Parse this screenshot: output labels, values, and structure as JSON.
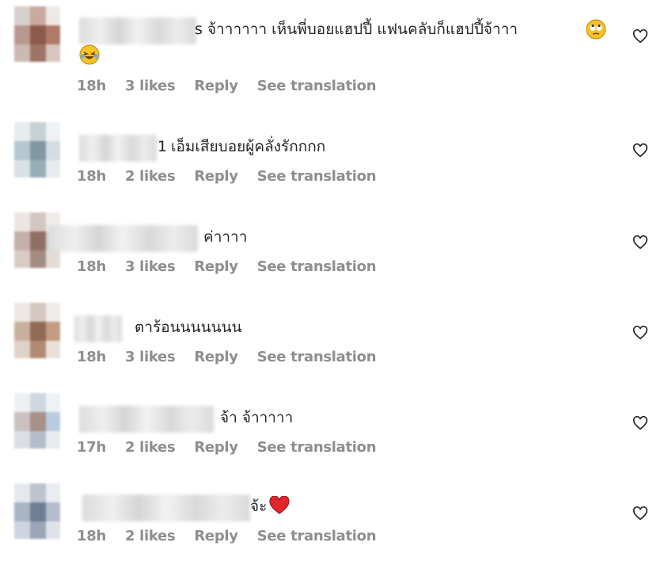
{
  "comments": [
    {
      "prefix": "s",
      "text": "จ้าาาาาา เห็นพี่บอยแฮปปี้ แฟนคลับก็แฮปปี้จ้าาา",
      "emoji": [
        "rolling-eyes-emoji",
        "laughing-tears-emoji"
      ],
      "time": "18h",
      "likes": "3 likes",
      "reply": "Reply",
      "translate": "See translation"
    },
    {
      "prefix": "1",
      "text": "เอ็มเสียบอยผู้คลั่งรักกกก",
      "time": "18h",
      "likes": "2 likes",
      "reply": "Reply",
      "translate": "See translation"
    },
    {
      "prefix": "",
      "text": "ค่าาาา",
      "time": "18h",
      "likes": "3 likes",
      "reply": "Reply",
      "translate": "See translation"
    },
    {
      "prefix": "",
      "text": "ตาร้อนนนนนนน",
      "time": "18h",
      "likes": "3 likes",
      "reply": "Reply",
      "translate": "See translation"
    },
    {
      "prefix": "",
      "text": "จ้า จ้าาาาา",
      "time": "17h",
      "likes": "2 likes",
      "reply": "Reply",
      "translate": "See translation"
    },
    {
      "prefix": "",
      "text": "จ้ะ",
      "emoji": [
        "red-heart-emoji"
      ],
      "time": "18h",
      "likes": "2 likes",
      "reply": "Reply",
      "translate": "See translation"
    }
  ],
  "colors": {
    "meta": "#8e8e8e",
    "text": "#262626",
    "heart_emoji": "#e0262b",
    "emoji_yellow": "#f7c325"
  }
}
